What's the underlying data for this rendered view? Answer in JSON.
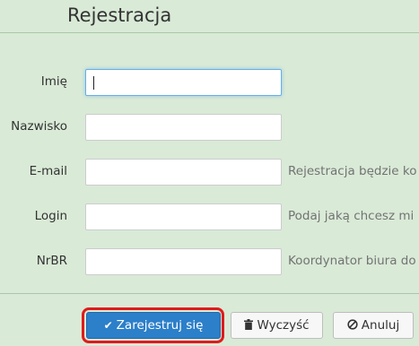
{
  "page": {
    "title": "Rejestracja"
  },
  "form": {
    "fields": [
      {
        "label": "Imię",
        "value": "",
        "help": ""
      },
      {
        "label": "Nazwisko",
        "value": "",
        "help": ""
      },
      {
        "label": "E-mail",
        "value": "",
        "help": "Rejestracja będzie ko"
      },
      {
        "label": "Login",
        "value": "",
        "help": "Podaj jaką chcesz mi"
      },
      {
        "label": "NrBR",
        "value": "",
        "help": "Koordynator biura do"
      }
    ]
  },
  "actions": {
    "register_label": "Zarejestruj się",
    "clear_label": "Wyczyść",
    "cancel_label": "Anuluj"
  },
  "colors": {
    "background": "#d9ead7",
    "primary": "#2c7fc9",
    "highlight": "#e01b1b"
  },
  "icons": {
    "register": "check-icon",
    "clear": "trash-icon",
    "cancel": "ban-icon"
  }
}
